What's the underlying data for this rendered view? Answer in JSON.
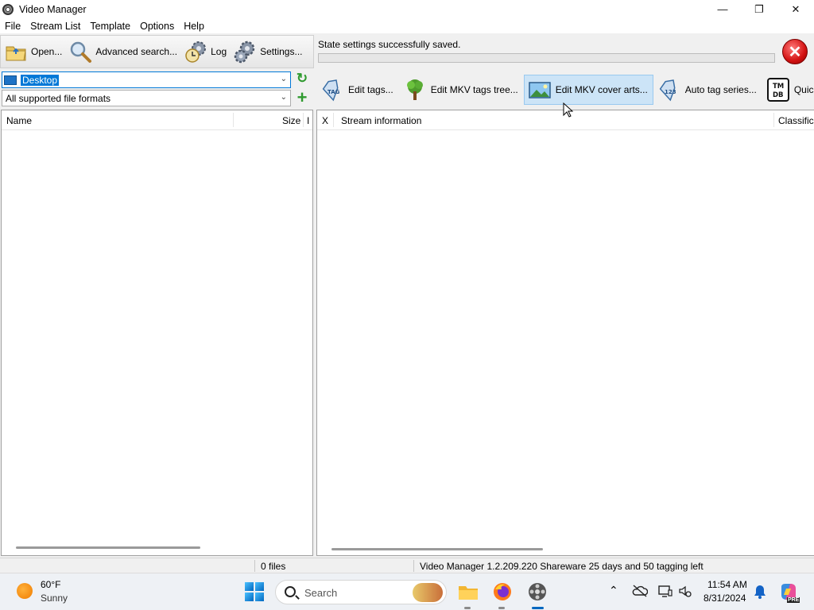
{
  "window": {
    "title": "Video Manager",
    "minimize": "—",
    "maximize": "❐",
    "close": "✕"
  },
  "menu": [
    "File",
    "Stream List",
    "Template",
    "Options",
    "Help"
  ],
  "toolbar": {
    "open_label": "Open...",
    "advanced_search_label": "Advanced search...",
    "log_label": "Log",
    "settings_label": "Settings..."
  },
  "status": {
    "message": "State settings successfully saved.",
    "progress": 0,
    "close_symbol": "✕"
  },
  "left_pane": {
    "folder_value": "Desktop",
    "format_value": "All supported file formats",
    "columns": [
      "Name",
      "Size",
      "I"
    ]
  },
  "tag_toolbar": [
    {
      "label": "Edit tags...",
      "icon": "tag-icon"
    },
    {
      "label": "Edit MKV tags tree...",
      "icon": "tree-icon"
    },
    {
      "label": "Edit MKV cover arts...",
      "icon": "picture-icon"
    },
    {
      "label": "Auto tag series...",
      "icon": "numbered-tag-icon"
    },
    {
      "label": "Quick tag fi",
      "icon": "tmdb-icon",
      "icon_text": "TM\nDB"
    }
  ],
  "stream_list": {
    "columns": [
      "X",
      "Stream information",
      "Classifica"
    ]
  },
  "statusbar": {
    "files": "0 files",
    "info": "Video Manager 1.2.209.220 Shareware 25 days and 50 tagging left"
  },
  "taskbar": {
    "temperature": "60°F",
    "condition": "Sunny",
    "search_placeholder": "Search",
    "time": "11:54 AM",
    "date": "8/31/2024",
    "copilot_badge": "PRE"
  }
}
